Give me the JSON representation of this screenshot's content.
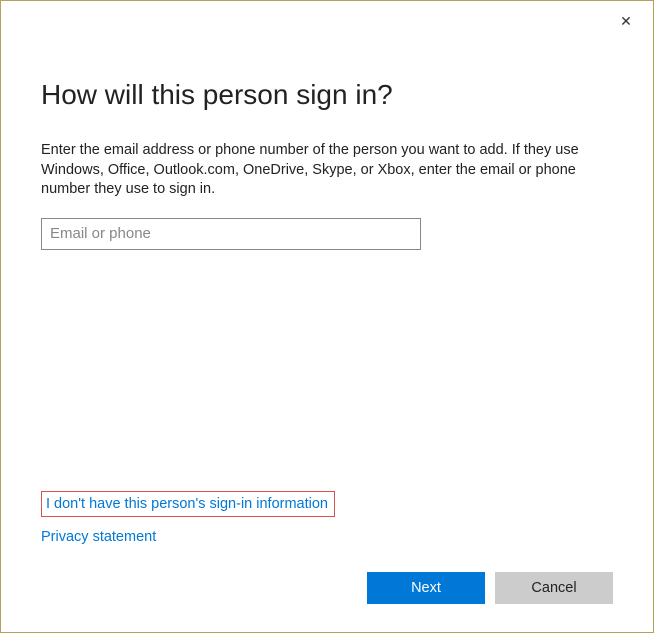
{
  "dialog": {
    "close_icon": "✕",
    "heading": "How will this person sign in?",
    "description": "Enter the email address or phone number of the person you want to add. If they use Windows, Office, Outlook.com, OneDrive, Skype, or Xbox, enter the email or phone number they use to sign in.",
    "input_placeholder": "Email or phone",
    "input_value": "",
    "links": {
      "no_info": "I don't have this person's sign-in information",
      "privacy": "Privacy statement"
    },
    "buttons": {
      "next": "Next",
      "cancel": "Cancel"
    }
  }
}
